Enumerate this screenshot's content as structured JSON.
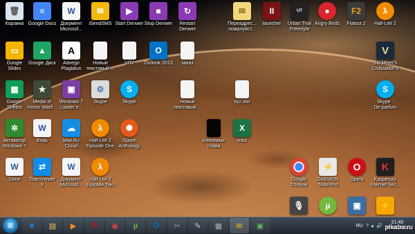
{
  "desktop_icons": [
    {
      "label": "Корзина",
      "icon": "recycle-bin-icon",
      "color": "#d9e6f0"
    },
    {
      "label": "Google Docs",
      "icon": "google-docs-icon",
      "color": "#4285f4"
    },
    {
      "label": "Документ\nMicrosof...",
      "icon": "word-document-icon",
      "color": "#2b579a"
    },
    {
      "label": "iSendSMS",
      "icon": "isendsms-icon",
      "color": "#f2b90f"
    },
    {
      "label": "Start Denwer",
      "icon": "denwer-start-icon",
      "color": "#8a3bb3"
    },
    {
      "label": "Stop Denwer",
      "icon": "denwer-stop-icon",
      "color": "#8a3bb3"
    },
    {
      "label": "Restart\nDenwer",
      "icon": "denwer-restart-icon",
      "color": "#8a3bb3"
    },
    {
      "label": "Переадрес...\nпожалуйст...",
      "icon": "envelope-icon",
      "color": "#f3d77c"
    },
    {
      "label": "launcher",
      "icon": "launcher-icon",
      "color": "#7a1414"
    },
    {
      "label": "Urban Trial\nFreestyle",
      "icon": "urban-trial-icon",
      "color": "#222222"
    },
    {
      "label": "Angry Birds",
      "icon": "angry-birds-icon",
      "color": "#d8262e"
    },
    {
      "label": "Flatout 2",
      "icon": "flatout-icon",
      "color": "#3b3b3b"
    },
    {
      "label": "Half-Life 2",
      "icon": "half-life-icon",
      "color": "#f08a00"
    },
    {
      "label": "Google\nSlides",
      "icon": "google-slides-icon",
      "color": "#f4b400"
    },
    {
      "label": "Google Диск",
      "icon": "google-drive-icon",
      "color": "#1fa463"
    },
    {
      "label": "Advego\nPlagiatus",
      "icon": "advego-icon",
      "color": "#ffffff"
    },
    {
      "label": "Новый\nтекстовый ...",
      "icon": "text-document-icon",
      "color": "#f4f4f4"
    },
    {
      "label": "ЧПУ",
      "icon": "text-document-icon",
      "color": "#f4f4f4"
    },
    {
      "label": "Outlook 2013",
      "icon": "outlook-icon",
      "color": "#0072c6"
    },
    {
      "label": "заказ",
      "icon": "text-document-icon",
      "color": "#f4f4f4"
    },
    {
      "label": "Sid Meier's\nCivilization 5",
      "icon": "civilization-icon",
      "color": "#1b2a3a"
    },
    {
      "label": "Google\nSheets",
      "icon": "google-sheets-icon",
      "color": "#0f9d58"
    },
    {
      "label": "Medal of\nHonor Warfi...",
      "icon": "medal-of-honor-icon",
      "color": "#3d4a3a"
    },
    {
      "label": "Windows 7\nLoader e...",
      "icon": "windows-loader-icon",
      "color": "#7b3ea3"
    },
    {
      "label": "Skype",
      "icon": "skype-file-icon",
      "color": "#dcdcdc"
    },
    {
      "label": "Skype",
      "icon": "skype-icon",
      "color": "#00aff0"
    },
    {
      "label": "Новый\nтекстовый ...",
      "icon": "text-document-icon",
      "color": "#f4f4f4"
    },
    {
      "label": "xyz.vbs",
      "icon": "vbs-file-icon",
      "color": "#f4f4f4"
    },
    {
      "label": "Skype -\nDe-parfum",
      "icon": "skype-icon",
      "color": "#00aff0"
    },
    {
      "label": "Активатор\nWindows 7",
      "icon": "activator-icon",
      "color": "#2e8b2e"
    },
    {
      "label": "Ведь",
      "icon": "word-document-icon",
      "color": "#2b579a"
    },
    {
      "label": "Mail.Ru\nCloud",
      "icon": "mailru-cloud-icon",
      "color": "#168de2"
    },
    {
      "label": "Half-Life 2\nEpisode One",
      "icon": "half-life-icon",
      "color": "#f08a00"
    },
    {
      "label": "Spore\nAnthology",
      "icon": "spore-icon",
      "color": "#e35b1a"
    },
    {
      "label": "ключевые\nслова",
      "icon": "black-file-icon",
      "color": "#050505"
    },
    {
      "label": "links",
      "icon": "excel-icon",
      "color": "#1e7145"
    },
    {
      "label": "Done",
      "icon": "word-document-icon",
      "color": "#2b579a"
    },
    {
      "label": "TeamViewer\n9",
      "icon": "teamviewer-icon",
      "color": "#0e8ee9"
    },
    {
      "label": "Документ\nMicrosof...",
      "icon": "word-document-icon",
      "color": "#2b579a"
    },
    {
      "label": "Half-Life 2\nEpisode Two",
      "icon": "half-life-icon",
      "color": "#f08a00"
    },
    {
      "label": "Google\nChrome",
      "icon": "chrome-icon",
      "color": "#db4437"
    },
    {
      "label": "DAEMON\nTools Pro",
      "icon": "daemon-tools-icon",
      "color": "#e8e8e8"
    },
    {
      "label": "Opera",
      "icon": "opera-icon",
      "color": "#cc0f16"
    },
    {
      "label": "Kaspersky\nInternet Sec...",
      "icon": "kaspersky-icon",
      "color": "#1f1f1f"
    },
    {
      "label": "",
      "icon": "microphone-icon",
      "color": "#444444"
    },
    {
      "label": "",
      "icon": "utorrent-icon",
      "color": "#76b83f"
    },
    {
      "label": "",
      "icon": "network-icon",
      "color": "#3a6ea5"
    },
    {
      "label": "",
      "icon": "winamp-icon",
      "color": "#f6a800"
    }
  ],
  "taskbar": {
    "start": "start-orb",
    "pinned": [
      {
        "icon": "ie-icon",
        "symbol": "e",
        "color": "#1e90ff"
      },
      {
        "icon": "explorer-icon",
        "symbol": "▤",
        "color": "#f1c453"
      },
      {
        "icon": "media-player-icon",
        "symbol": "▶",
        "color": "#ff8c1a"
      },
      {
        "icon": "opera-taskbar-icon",
        "symbol": "O",
        "color": "#cc0f16"
      },
      {
        "icon": "chrome-taskbar-icon",
        "symbol": "◉",
        "color": "#db4437"
      },
      {
        "icon": "utorrent-taskbar-icon",
        "symbol": "µ",
        "color": "#76b83f"
      },
      {
        "icon": "outlook-taskbar-icon",
        "symbol": "O",
        "color": "#0072c6"
      },
      {
        "icon": "tools-taskbar-icon",
        "symbol": "✂",
        "color": "#999999"
      },
      {
        "icon": "paint-taskbar-icon",
        "symbol": "✎",
        "color": "#cccccc"
      },
      {
        "icon": "calculator-taskbar-icon",
        "symbol": "▦",
        "color": "#aaaaaa"
      },
      {
        "icon": "isendsms-taskbar-icon",
        "symbol": "✉",
        "color": "#f2b90f"
      },
      {
        "icon": "network-taskbar-icon",
        "symbol": "▣",
        "color": "#5cb85c"
      }
    ],
    "tray": {
      "language": "RU",
      "time": "21:40",
      "date": "06.05.2014"
    }
  },
  "watermark": "pikabu.ru"
}
